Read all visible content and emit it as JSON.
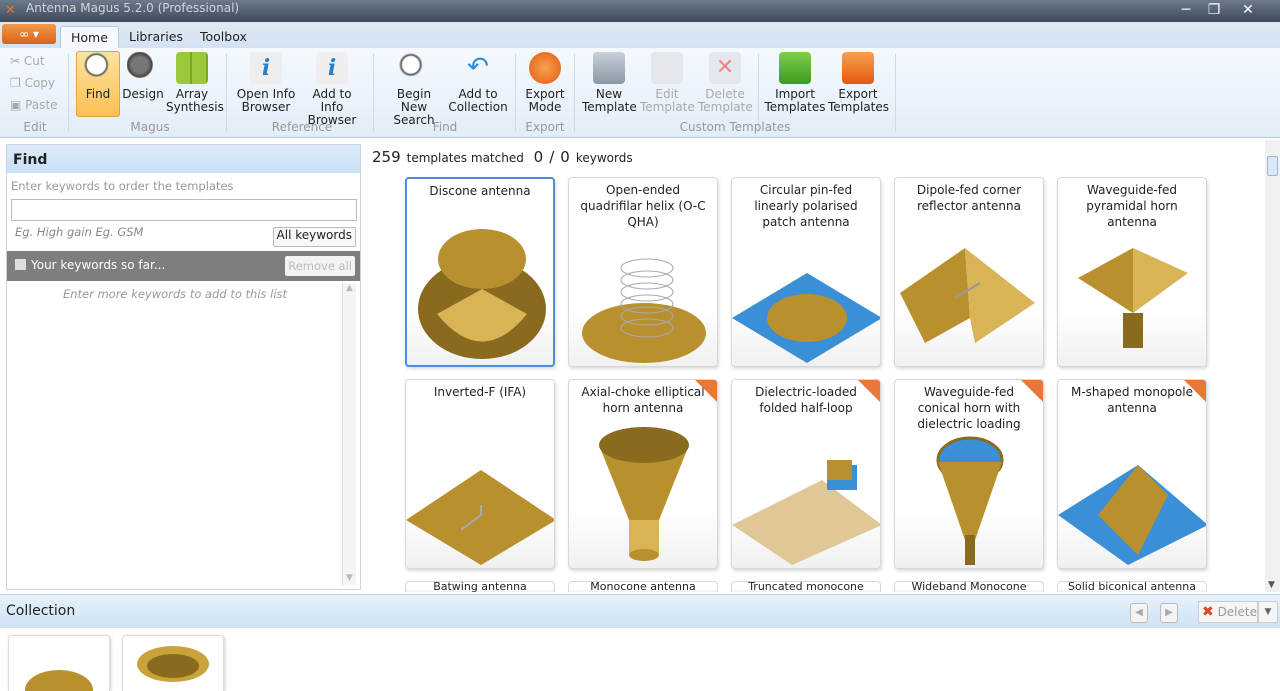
{
  "window": {
    "title": "Antenna Magus 5.2.0 (Professional)",
    "minimize": "─",
    "maximize": "❐",
    "close": "✕"
  },
  "tabs": [
    {
      "label": "Home"
    },
    {
      "label": "Libraries"
    },
    {
      "label": "Toolbox"
    }
  ],
  "ribbon": {
    "edit": {
      "cut": "Cut",
      "copy": "Copy",
      "paste": "Paste",
      "group": "Edit"
    },
    "magus": {
      "find": "Find",
      "design": "Design",
      "array1": "Array",
      "array2": "Synthesis",
      "group": "Magus"
    },
    "reference": {
      "open1": "Open Info",
      "open2": "Browser",
      "add1": "Add to Info",
      "add2": "Browser",
      "group": "Reference"
    },
    "find": {
      "begin1": "Begin New",
      "begin2": "Search",
      "addc1": "Add to",
      "addc2": "Collection",
      "group": "Find"
    },
    "export": {
      "mode1": "Export",
      "mode2": "Mode",
      "group": "Export"
    },
    "custom": {
      "new1": "New",
      "new2": "Template",
      "edit1": "Edit",
      "edit2": "Template",
      "del1": "Delete",
      "del2": "Template",
      "imp1": "Import",
      "imp2": "Templates",
      "exp1": "Export",
      "exp2": "Templates",
      "group": "Custom Templates"
    }
  },
  "find_panel": {
    "title": "Find",
    "hint": "Enter keywords to order the templates",
    "keyword_value": "",
    "examples": "Eg. High gain  Eg. GSM",
    "all_keywords": "All keywords",
    "your_keywords": "Your keywords so far...",
    "remove_all": "Remove all",
    "list_hint": "Enter more keywords to add to this list"
  },
  "results": {
    "count": "259",
    "matched_label": "templates matched",
    "kw_matched": "0",
    "slash": "/",
    "kw_total": "0",
    "keywords_label": "keywords"
  },
  "templates": [
    {
      "label": "Discone antenna",
      "icon": "discone",
      "selected": true
    },
    {
      "label": "Open-ended quadrifilar helix (O-C QHA)",
      "icon": "helix"
    },
    {
      "label": "Circular pin-fed linearly polarised patch antenna",
      "icon": "patch"
    },
    {
      "label": "Dipole-fed corner reflector antenna",
      "icon": "corner"
    },
    {
      "label": "Waveguide-fed pyramidal horn antenna",
      "icon": "horn"
    },
    {
      "label": "Inverted-F (IFA)",
      "icon": "ifa"
    },
    {
      "label": "Axial-choke elliptical horn antenna",
      "icon": "choke",
      "new": true
    },
    {
      "label": "Dielectric-loaded folded half-loop",
      "icon": "loop",
      "new": true
    },
    {
      "label": "Waveguide-fed conical horn with dielectric loading",
      "icon": "cone",
      "new": true
    },
    {
      "label": "M-shaped monopole antenna",
      "icon": "mshape",
      "new": true
    },
    {
      "label": "Batwing antenna",
      "icon": "none"
    },
    {
      "label": "Monocone antenna",
      "icon": "none"
    },
    {
      "label": "Truncated monocone",
      "icon": "none"
    },
    {
      "label": "Wideband Monocone",
      "icon": "none"
    },
    {
      "label": "Solid biconical antenna",
      "icon": "none"
    }
  ],
  "collection": {
    "title": "Collection",
    "delete": "Delete",
    "prev": "◀",
    "next": "▶"
  },
  "colors": {
    "gold": "#b8902e",
    "blue": "#3a8fd6",
    "accent": "#e8783a"
  }
}
